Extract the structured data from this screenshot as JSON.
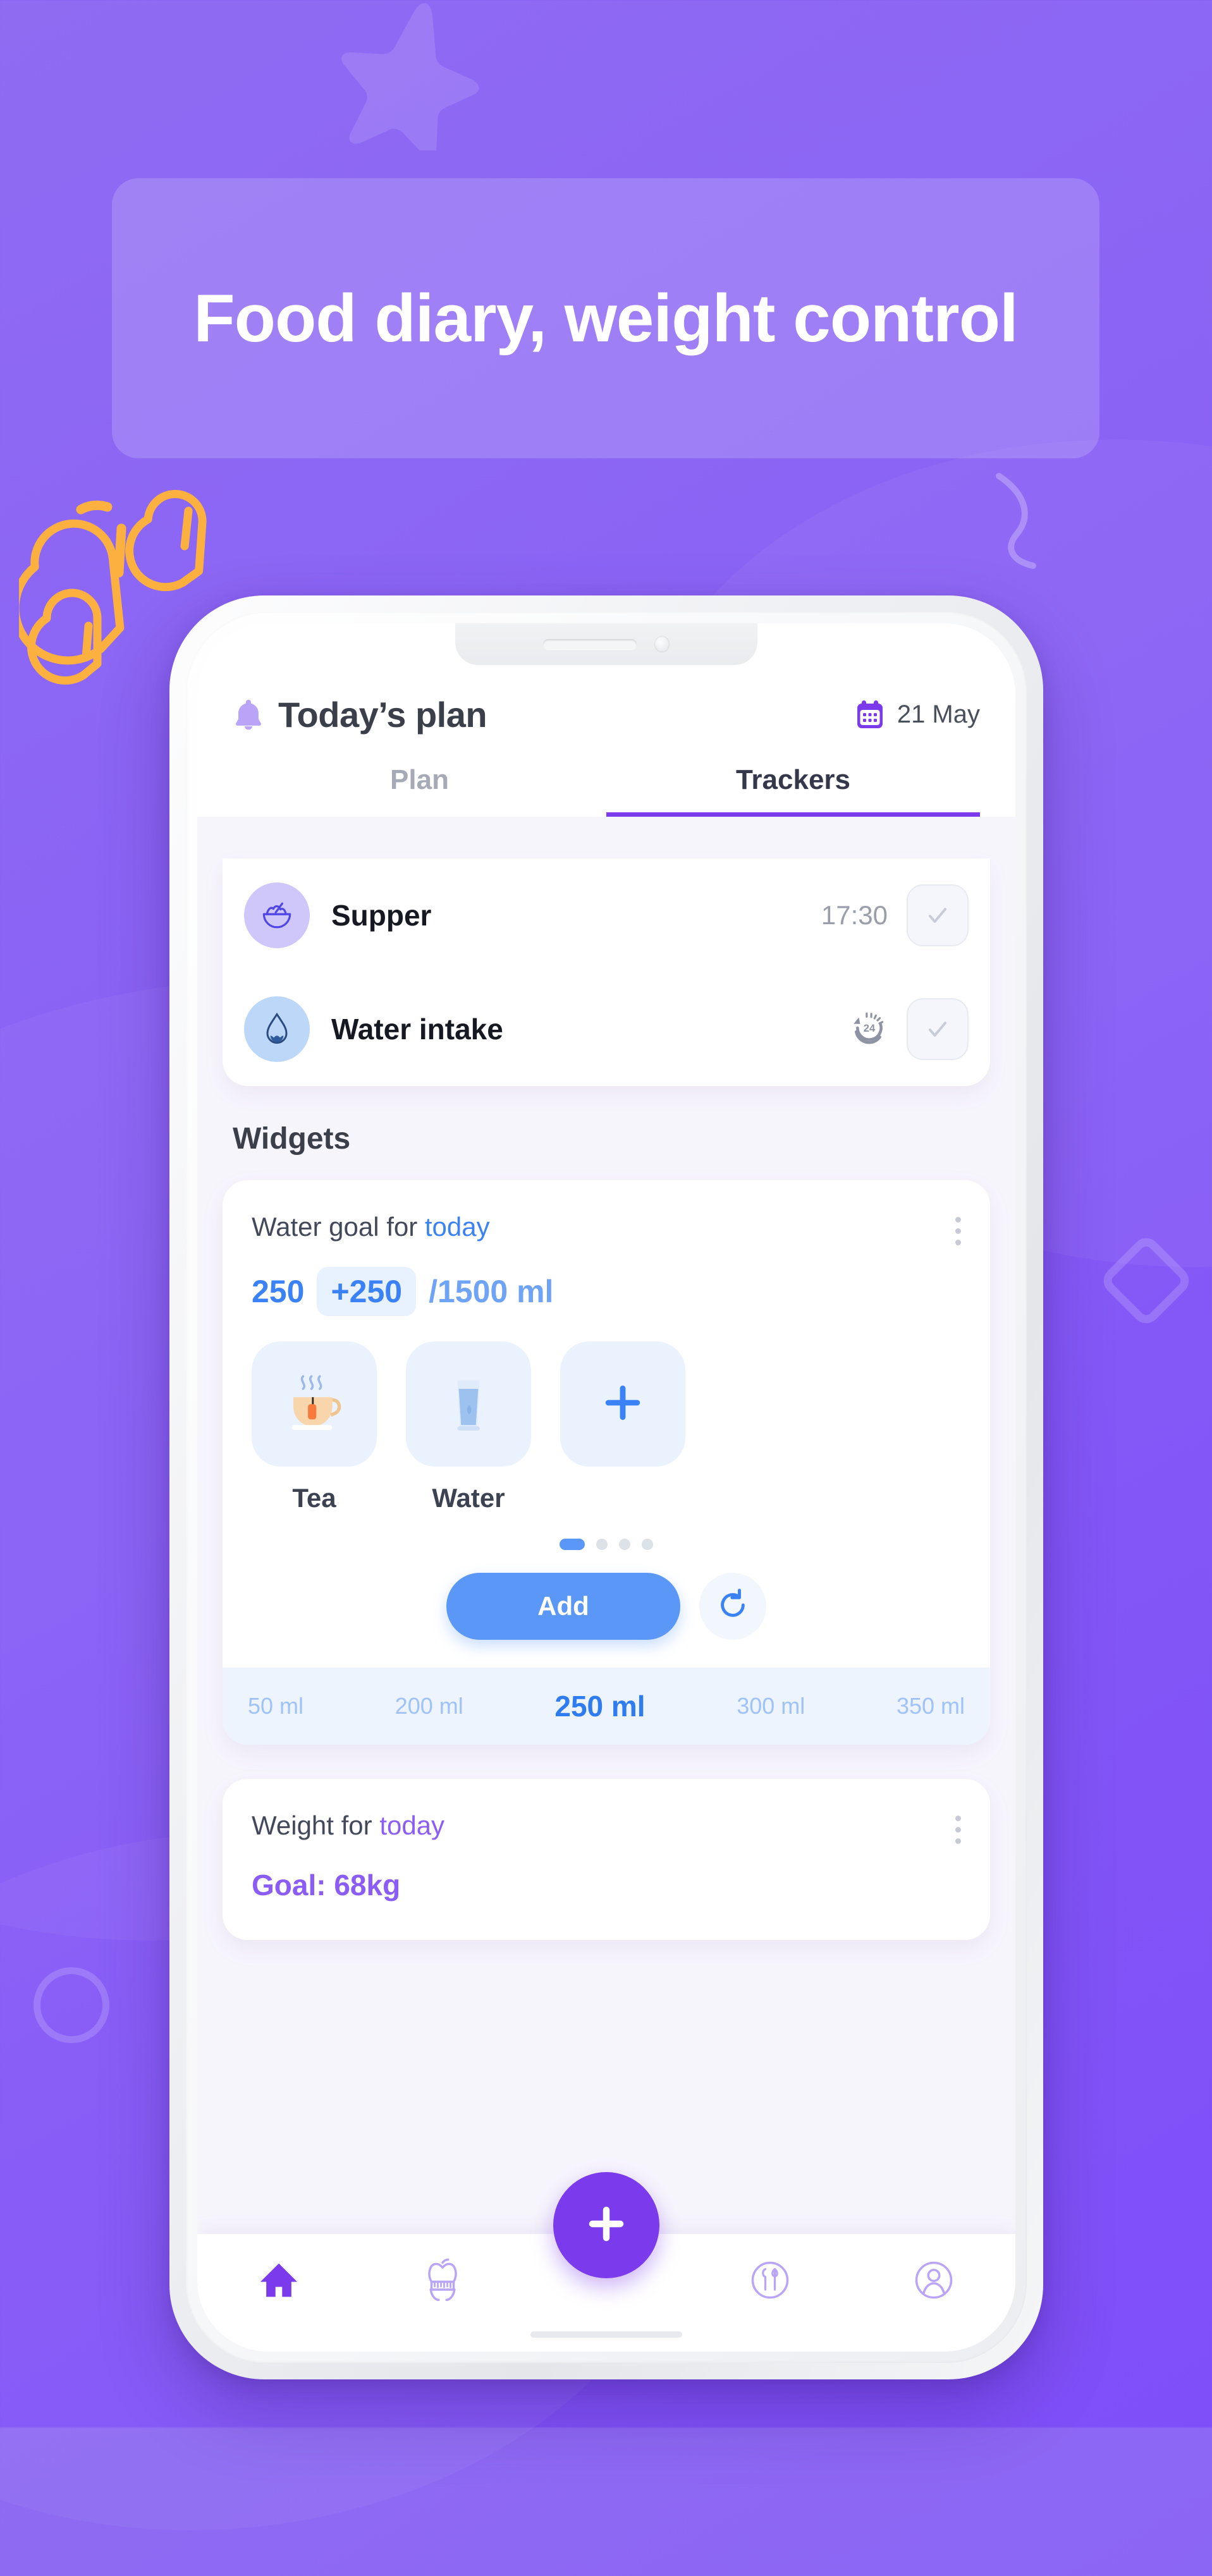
{
  "promo": {
    "headline": "Food diary, weight control",
    "background_color": "#8a63f5",
    "banner_color": "rgba(255,255,255,0.17)"
  },
  "app": {
    "header": {
      "bell_icon": "bell-icon",
      "title": "Today’s plan",
      "calendar_icon": "calendar-icon",
      "date": "21 May"
    },
    "tabs": [
      {
        "label": "Plan",
        "active": false
      },
      {
        "label": "Trackers",
        "active": true
      }
    ],
    "trackers": [
      {
        "icon": "bowl-icon",
        "label": "Supper",
        "time": "17:30",
        "check_icon": "check-icon"
      },
      {
        "icon": "water-drop-icon",
        "label": "Water intake",
        "time_icon": "24h-repeat-icon",
        "check_icon": "check-icon"
      }
    ],
    "widgets_section_title": "Widgets",
    "water_widget": {
      "title_prefix": "Water goal for ",
      "title_accent": "today",
      "current": "250",
      "delta": "+250",
      "total": "/1500 ml",
      "accent_color": "#3b82f6",
      "drinks": [
        {
          "icon": "tea-cup-icon",
          "label": "Tea"
        },
        {
          "icon": "water-glass-icon",
          "label": "Water"
        },
        {
          "icon": "plus-icon",
          "label": ""
        }
      ],
      "pager": {
        "count": 4,
        "active_index": 0
      },
      "add_label": "Add",
      "reset_icon": "refresh-icon",
      "kebab_icon": "kebab-menu-icon",
      "ml_scale": [
        "50 ml",
        "200 ml",
        "250 ml",
        "300 ml",
        "350 ml"
      ],
      "ml_selected_index": 2
    },
    "weight_widget": {
      "title_prefix": "Weight for ",
      "title_accent": "today",
      "goal": "Goal: 68kg",
      "accent_color": "#8b5cf6",
      "kebab_icon": "kebab-menu-icon"
    },
    "bottom_nav": [
      {
        "icon": "home-icon",
        "active": true
      },
      {
        "icon": "apple-measure-icon",
        "active": false
      },
      {
        "icon": "plate-cutlery-icon",
        "active": false
      },
      {
        "icon": "profile-icon",
        "active": false
      }
    ],
    "fab_icon": "plus-icon"
  },
  "decorations": [
    "star-shape",
    "squiggle-shape",
    "diamond-outline-shape",
    "circle-outline-shape",
    "leaf-outline-shapes"
  ]
}
